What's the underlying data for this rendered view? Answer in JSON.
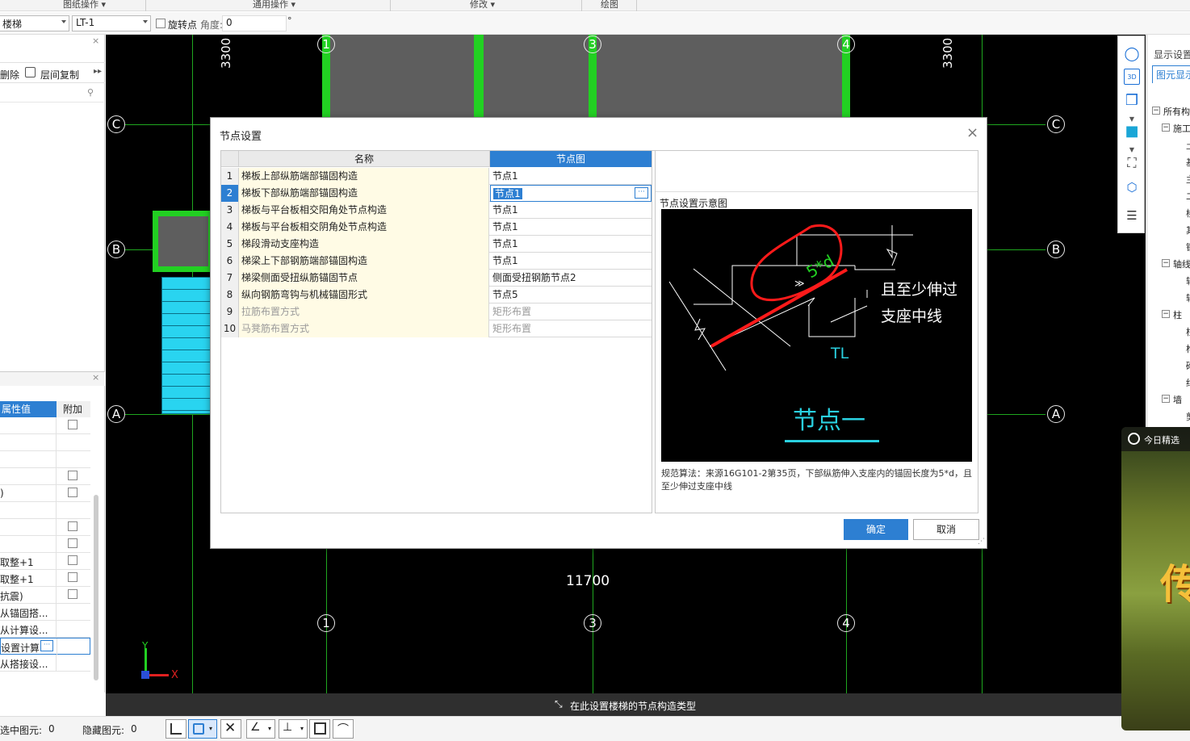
{
  "ribbon": {
    "groups": [
      "图纸操作",
      "通用操作",
      "修改",
      "绘图"
    ]
  },
  "toolbar": {
    "component_type": "楼梯",
    "component_name": "LT-1",
    "rotate_label": "旋转点",
    "angle_label": "角度:",
    "angle_value": "0",
    "degree_symbol": "°"
  },
  "left_panel": {
    "delete_label": "删除",
    "copy_label": "层间复制",
    "prop_header_value": "属性值",
    "prop_header_extra": "附加",
    "prop_values": [
      "",
      "",
      "",
      "",
      ")",
      "",
      "",
      "",
      "取整+1",
      "取整+1",
      "抗震)",
      "从锚固搭...",
      "从计算设...",
      "设置计算",
      "从搭接设..."
    ]
  },
  "canvas": {
    "axis_cols": [
      "1",
      "3",
      "4"
    ],
    "axis_rows": [
      "C",
      "B",
      "A"
    ],
    "dim_left": "3300",
    "dim_right": "3300",
    "dim_bottom": "11700",
    "ucs_y": "Y",
    "ucs_x": "X"
  },
  "dialog": {
    "title": "节点设置",
    "col_name": "名称",
    "col_node": "节点图",
    "rows": [
      {
        "no": "1",
        "name": "梯板上部纵筋端部锚固构造",
        "node": "节点1"
      },
      {
        "no": "2",
        "name": "梯板下部纵筋端部锚固构造",
        "node": "节点1"
      },
      {
        "no": "3",
        "name": "梯板与平台板相交阳角处节点构造",
        "node": "节点1"
      },
      {
        "no": "4",
        "name": "梯板与平台板相交阴角处节点构造",
        "node": "节点1"
      },
      {
        "no": "5",
        "name": "梯段滑动支座构造",
        "node": "节点1"
      },
      {
        "no": "6",
        "name": "梯梁上下部钢筋端部锚固构造",
        "node": "节点1"
      },
      {
        "no": "7",
        "name": "梯梁侧面受扭纵筋锚固节点",
        "node": "侧面受扭钢筋节点2"
      },
      {
        "no": "8",
        "name": "纵向钢筋弯钩与机械锚固形式",
        "node": "节点5"
      },
      {
        "no": "9",
        "name": "拉筋布置方式",
        "node": "矩形布置"
      },
      {
        "no": "10",
        "name": "马凳筋布置方式",
        "node": "矩形布置"
      }
    ],
    "preview_title": "节点设置示意图",
    "diagram": {
      "anchor_text": "5*d",
      "note_line1": "且至少伸过",
      "note_line2": "支座中线",
      "beam_label": "TL",
      "node_title": "节点一"
    },
    "description": "规范算法：来源16G101-2第35页，下部纵筋伸入支座内的锚固长度为5*d，且至少伸过支座中线",
    "ok_label": "确定",
    "cancel_label": "取消"
  },
  "status": {
    "hint": "在此设置楼梯的节点构造类型"
  },
  "bottom": {
    "selected_label": "选中图元:",
    "selected_value": "0",
    "hidden_label": "隐藏图元:",
    "hidden_value": "0"
  },
  "right_panel": {
    "title": "显示设置",
    "tab": "图元显示",
    "tree_items": [
      "图",
      "所有构",
      "施工",
      "土",
      "基",
      "主",
      "二",
      "楼",
      "其",
      "钢",
      "轴线",
      "轴",
      "轴",
      "柱",
      "柱",
      "构",
      "砌",
      "约",
      "墙",
      "剪"
    ]
  },
  "ad": {
    "label": "今日精选",
    "big_char": "传"
  }
}
